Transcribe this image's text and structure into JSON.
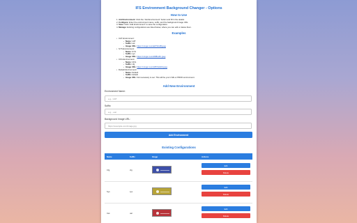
{
  "page_title": "IFS Environment Background Changer - Options",
  "how_to": {
    "heading": "How to Use",
    "steps": [
      {
        "num": "1.",
        "bold": "Add Environment:",
        "text": " Click the \"Add Environment\" button and fill in the details."
      },
      {
        "num": "2.",
        "bold": "Configure:",
        "text": " Enter the environment name, suffix, and the background image URL."
      },
      {
        "num": "3.",
        "bold": "Save:",
        "text": " Click \"Add Environment\" to save the configuration."
      },
      {
        "num": "4.",
        "bold": "Manage:",
        "text": " Existing configurations are listed below, where you can edit or delete them."
      }
    ]
  },
  "examples": {
    "heading": "Examples",
    "items": [
      {
        "title": "UAT Environment:",
        "name_label": "Name:",
        "name": "UAT",
        "suffix_label": "Suffix:",
        "suffix": "uat",
        "url_label": "Image URL:",
        "url": "https://i.imgur.com/abTDcAB.jpeg"
      },
      {
        "title": "SYS Environment:",
        "name_label": "Name:",
        "name": "SYS",
        "suffix_label": "Suffix:",
        "suffix": "sys",
        "url_label": "Image URL:",
        "url": "https://i.imgur.com/dNBtuZC.jpeg"
      },
      {
        "title": "CFG Environment:",
        "name_label": "Name:",
        "name": "CFG",
        "suffix_label": "Suffix:",
        "suffix": "cfg",
        "url_label": "Image URL:",
        "url": "https://i.imgur.com/HPOGGDd.jpeg"
      },
      {
        "title": "Default Environment:",
        "name_label": "Name:",
        "name": "Default",
        "suffix_label": "Suffix:",
        "suffix": "default",
        "url_label": "Image URL:",
        "url": "Not necessary to set. This will be your LIVE or PROD environment."
      }
    ]
  },
  "add_form": {
    "heading": "Add New Environment",
    "name_label": "Environment Name:",
    "name_placeholder": "e.g., UAT",
    "suffix_label": "Suffix:",
    "suffix_placeholder": "e.g., -uat",
    "url_label": "Background Image URL:",
    "url_placeholder": "https://example.com/image.jpg",
    "submit_label": "Add Environment"
  },
  "configs": {
    "heading": "Existing Configurations",
    "columns": [
      "Name",
      "Suffix",
      "Image",
      "Actions"
    ],
    "rows": [
      {
        "name": "Cfg",
        "suffix": "cfg",
        "thumb_color": "#3d4fa8",
        "edit_label": "Edit",
        "delete_label": "Delete"
      },
      {
        "name": "Sys",
        "suffix": "sys",
        "thumb_color": "#b8a437",
        "edit_label": "Edit",
        "delete_label": "Delete"
      },
      {
        "name": "Uat",
        "suffix": "uat",
        "thumb_color": "#b8333a",
        "edit_label": "Edit",
        "delete_label": "Delete"
      }
    ]
  },
  "colors": {
    "accent": "#2b7de0",
    "danger": "#e8433f",
    "heading": "#1f6fd1"
  }
}
